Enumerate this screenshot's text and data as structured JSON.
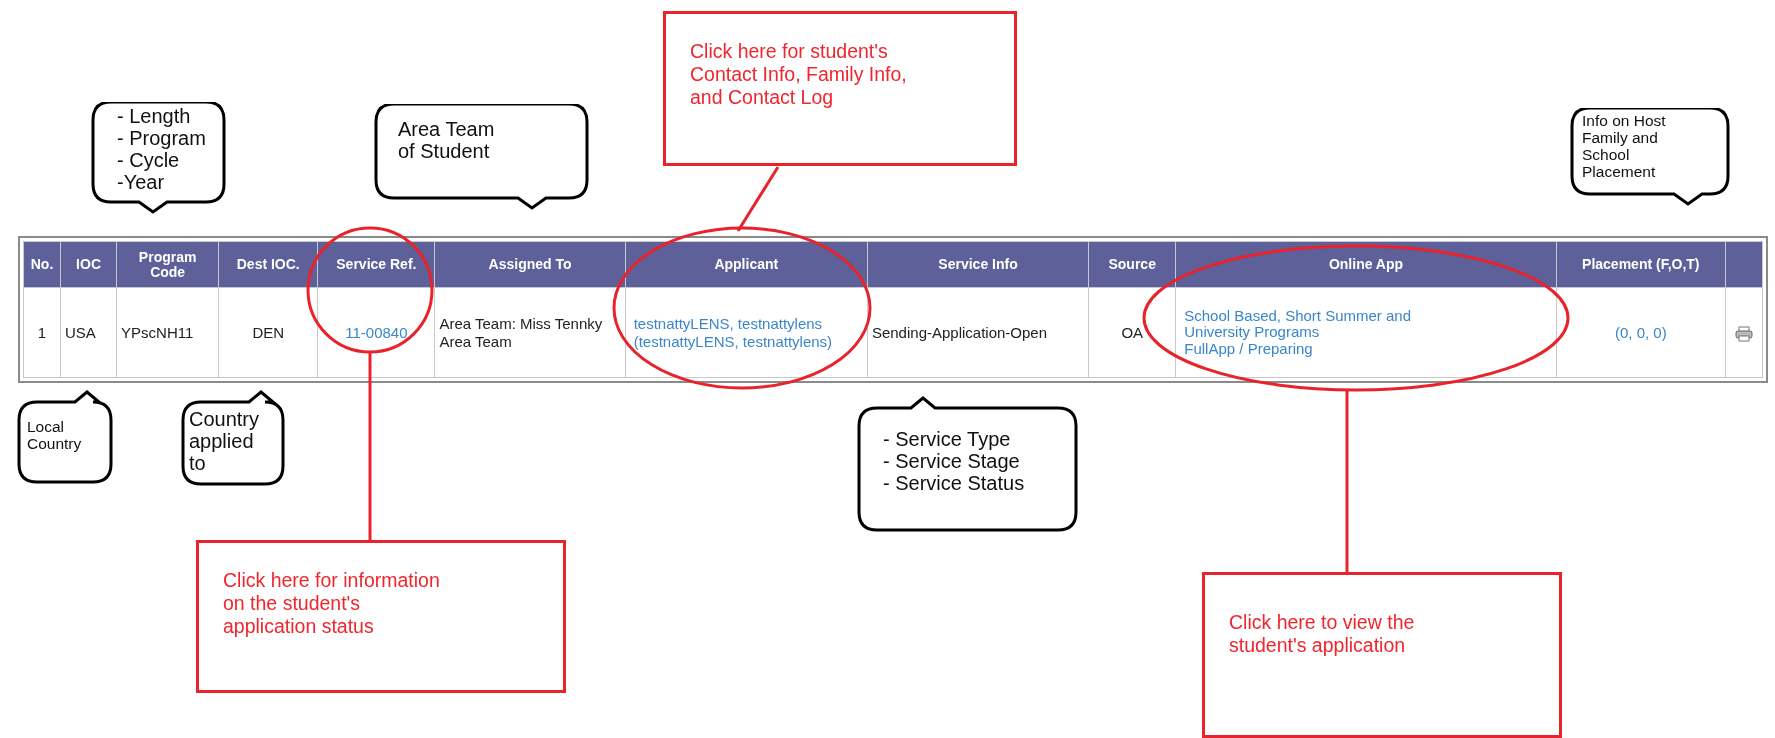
{
  "table": {
    "columns": [
      "No.",
      "IOC",
      "Program Code",
      "Dest IOC.",
      "Service Ref.",
      "Assigned To",
      "Applicant",
      "Service Info",
      "Source",
      "Online App",
      "Placement (F,O,T)"
    ],
    "rows": [
      {
        "no": "1",
        "ioc": "USA",
        "program_code": "YPscNH11",
        "dest_ioc": "DEN",
        "service_ref": "11-00840",
        "assigned_to": "Area Team: Miss Tennky Area Team",
        "applicant": "testnattyLENS, testnattylens (testnattyLENS, testnattylens)",
        "service_info": "Sending-Application-Open",
        "source": "OA",
        "online_app": [
          "School Based, Short Summer and University Programs",
          "FullApp / Preparing"
        ],
        "placement": "(0, 0, 0)"
      }
    ]
  },
  "callouts": [
    {
      "text": "- Length\n- Program\n- Cycle\n-Year"
    },
    {
      "text": "Area Team\nof Student"
    },
    {
      "text": "Info on Host\nFamily and\nSchool\nPlacement"
    },
    {
      "text": "Local\nCountry"
    },
    {
      "text": "Country\napplied\nto"
    },
    {
      "text": "- Service Type\n- Service Stage\n- Service Status"
    }
  ],
  "notes": [
    {
      "text": "Click here for  student's\nContact Info, Family Info,\nand Contact Log"
    },
    {
      "text": "Click here for information\non the student's\napplication status"
    },
    {
      "text": "Click here to view the\nstudent's application"
    }
  ]
}
